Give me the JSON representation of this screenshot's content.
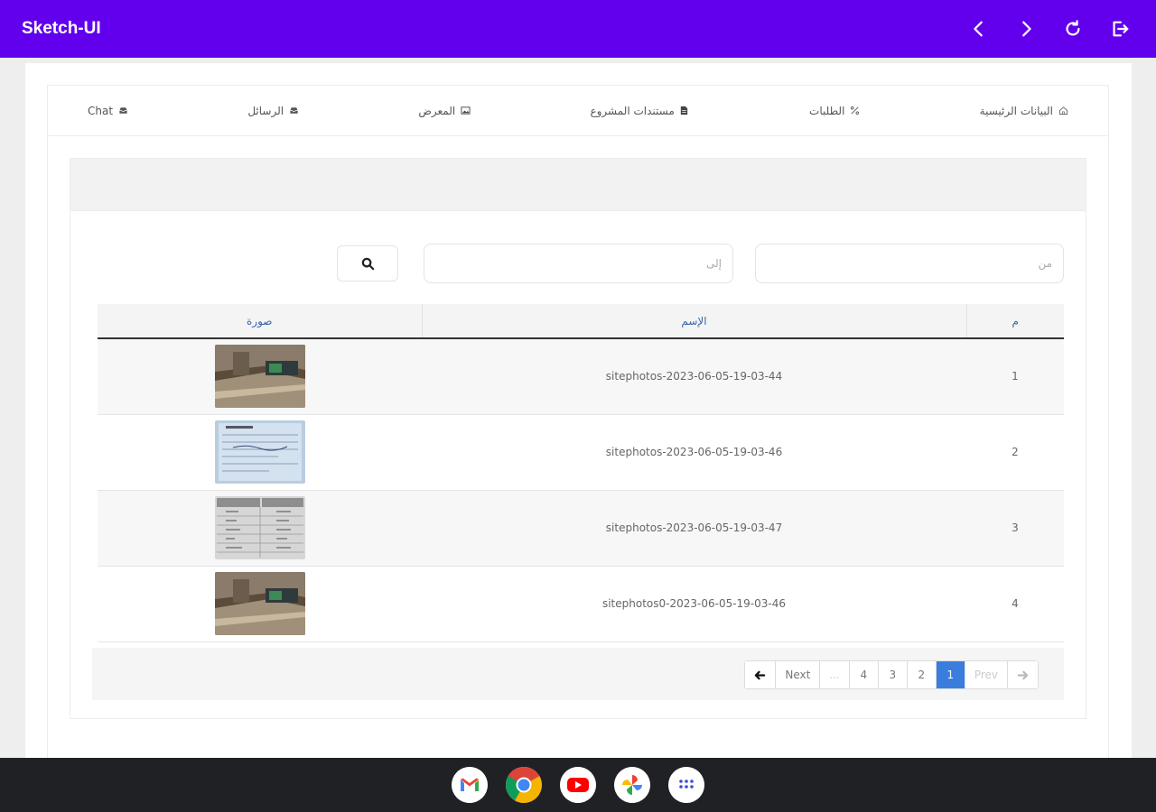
{
  "app": {
    "title": "Sketch-UI"
  },
  "tabs": [
    {
      "label": "البيانات الرئيسية",
      "icon": "home-icon"
    },
    {
      "label": "الطلبات",
      "icon": "percent-icon"
    },
    {
      "label": "مستندات المشروع",
      "icon": "document-icon"
    },
    {
      "label": "المعرض",
      "icon": "image-icon"
    },
    {
      "label": "الرسائل",
      "icon": "inbox-icon"
    },
    {
      "label": "Chat",
      "icon": "inbox-icon"
    }
  ],
  "filters": {
    "from_placeholder": "من",
    "to_placeholder": "إلى"
  },
  "table": {
    "headers": {
      "num": "م",
      "name": "الإسم",
      "image": "صورة"
    },
    "rows": [
      {
        "num": "1",
        "name": "sitephotos-2023-06-05-19-03-44",
        "thumb": "room-photo"
      },
      {
        "num": "2",
        "name": "sitephotos-2023-06-05-19-03-46",
        "thumb": "paper-form"
      },
      {
        "num": "3",
        "name": "sitephotos-2023-06-05-19-03-47",
        "thumb": "paper-table"
      },
      {
        "num": "4",
        "name": "sitephotos0-2023-06-05-19-03-46",
        "thumb": "room-photo"
      }
    ]
  },
  "pagination": {
    "prev": "Prev",
    "pages": [
      "1",
      "2",
      "3",
      "4"
    ],
    "ellipsis": "...",
    "next": "Next",
    "active_page": "1"
  },
  "colors": {
    "appbar": "#6200ee",
    "active_page": "#3b7ddd",
    "header_text": "#3a66a8"
  }
}
